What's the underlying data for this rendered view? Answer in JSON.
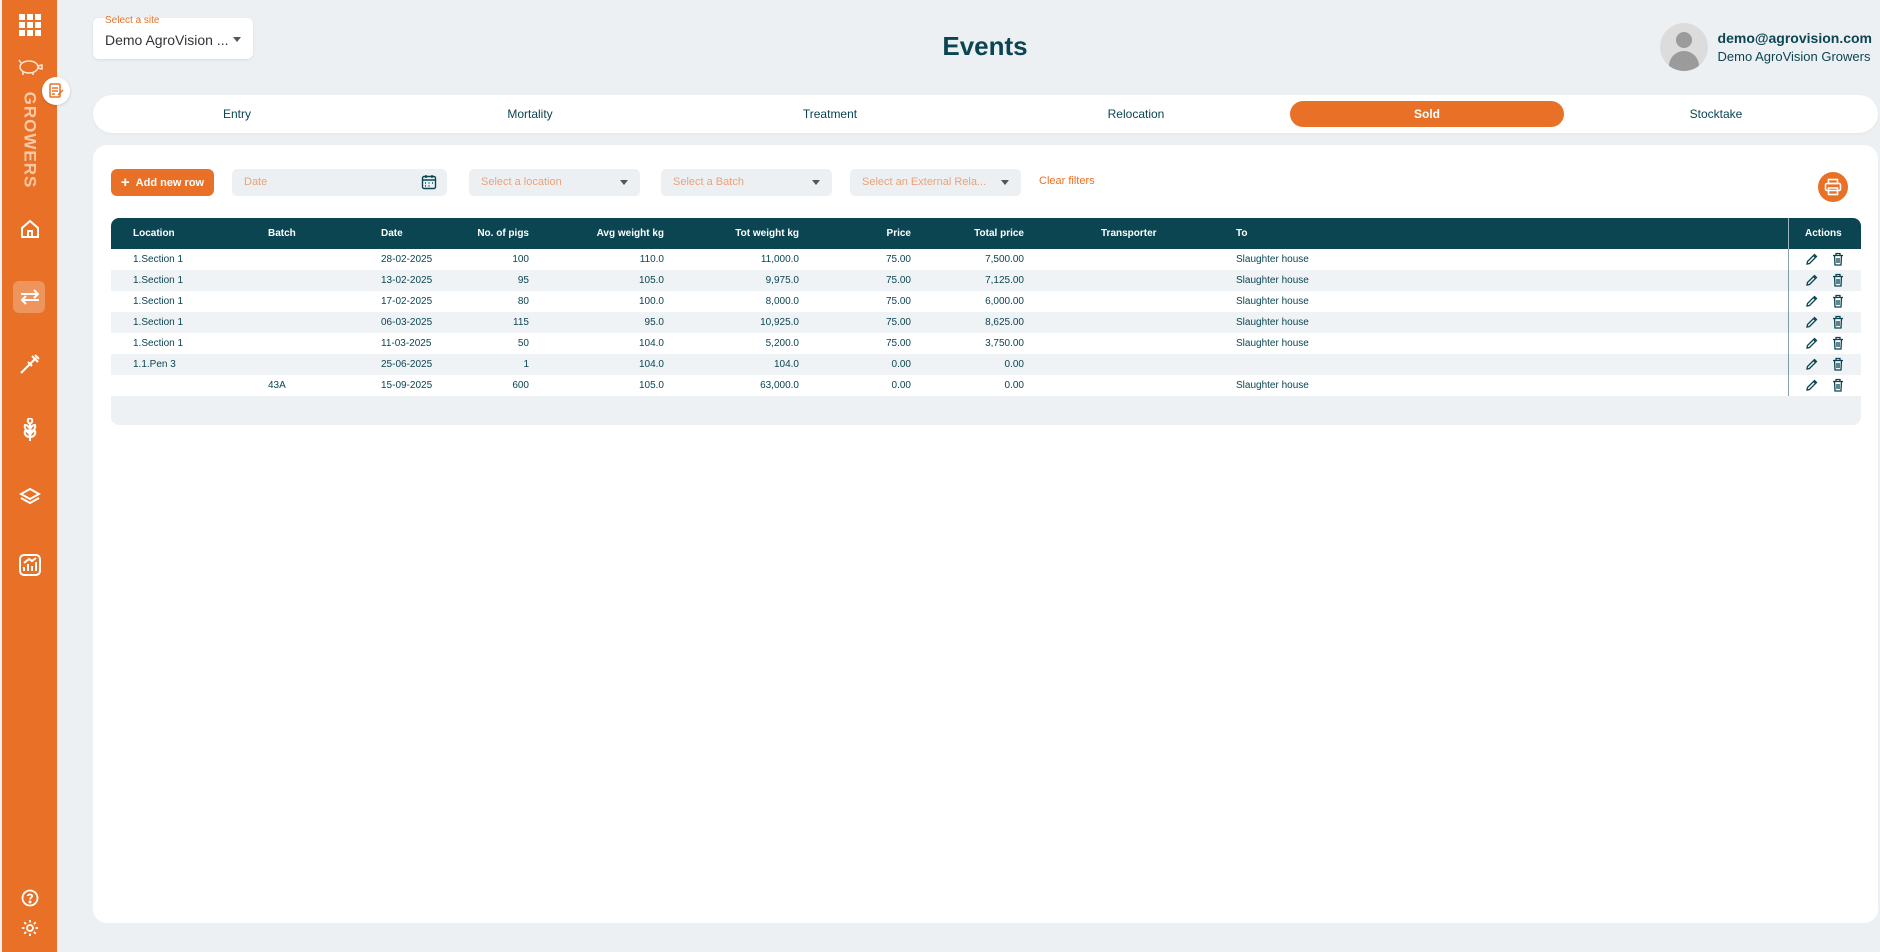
{
  "sidebar": {
    "brand_label": "GROWERS",
    "icons": [
      "apps-grid-icon",
      "pig-icon",
      "notes-icon",
      "home-icon",
      "transfer-icon",
      "syringe-icon",
      "grain-icon",
      "layers-icon",
      "report-icon",
      "help-icon",
      "settings-icon"
    ],
    "accent_color": "#e97127"
  },
  "header": {
    "site_select_label": "Select a site",
    "site_select_value": "Demo AgroVision ...",
    "title": "Events",
    "user_email": "demo@agrovision.com",
    "user_org": "Demo AgroVision Growers"
  },
  "tabs": [
    {
      "label": "Entry"
    },
    {
      "label": "Mortality"
    },
    {
      "label": "Treatment"
    },
    {
      "label": "Relocation"
    },
    {
      "label": "Sold",
      "active": true
    },
    {
      "label": "Stocktake"
    }
  ],
  "toolbar": {
    "add_label": "Add new row",
    "date_placeholder": "Date",
    "location_placeholder": "Select a location",
    "batch_placeholder": "Select a Batch",
    "external_placeholder": "Select an External Rela...",
    "clear_label": "Clear filters"
  },
  "table": {
    "columns": [
      "Location",
      "Batch",
      "Date",
      "No. of pigs",
      "Avg weight kg",
      "Tot weight kg",
      "Price",
      "Total price",
      "Transporter",
      "To",
      "Actions"
    ],
    "rows": [
      {
        "location": "1.Section 1",
        "batch": "",
        "date": "28-02-2025",
        "pigs": "100",
        "avg": "110.0",
        "tot": "11,000.0",
        "price": "75.00",
        "total": "7,500.00",
        "transporter": "",
        "to": "Slaughter house"
      },
      {
        "location": "1.Section 1",
        "batch": "",
        "date": "13-02-2025",
        "pigs": "95",
        "avg": "105.0",
        "tot": "9,975.0",
        "price": "75.00",
        "total": "7,125.00",
        "transporter": "",
        "to": "Slaughter house"
      },
      {
        "location": "1.Section 1",
        "batch": "",
        "date": "17-02-2025",
        "pigs": "80",
        "avg": "100.0",
        "tot": "8,000.0",
        "price": "75.00",
        "total": "6,000.00",
        "transporter": "",
        "to": "Slaughter house"
      },
      {
        "location": "1.Section 1",
        "batch": "",
        "date": "06-03-2025",
        "pigs": "115",
        "avg": "95.0",
        "tot": "10,925.0",
        "price": "75.00",
        "total": "8,625.00",
        "transporter": "",
        "to": "Slaughter house"
      },
      {
        "location": "1.Section 1",
        "batch": "",
        "date": "11-03-2025",
        "pigs": "50",
        "avg": "104.0",
        "tot": "5,200.0",
        "price": "75.00",
        "total": "3,750.00",
        "transporter": "",
        "to": "Slaughter house"
      },
      {
        "location": "1.1.Pen 3",
        "batch": "",
        "date": "25-06-2025",
        "pigs": "1",
        "avg": "104.0",
        "tot": "104.0",
        "price": "0.00",
        "total": "0.00",
        "transporter": "",
        "to": ""
      },
      {
        "location": "",
        "batch": "43A",
        "date": "15-09-2025",
        "pigs": "600",
        "avg": "105.0",
        "tot": "63,000.0",
        "price": "0.00",
        "total": "0.00",
        "transporter": "",
        "to": "Slaughter house"
      }
    ]
  }
}
